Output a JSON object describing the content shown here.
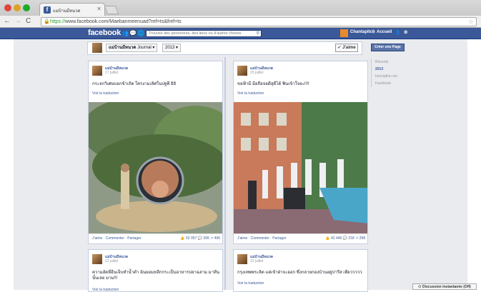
{
  "browser": {
    "tab_title": "แม่บ้านมีหนวด",
    "url_prefix": "https://",
    "url_rest": "www.facebook.com/Maebanmeenuad?ref=ts&fref=ts"
  },
  "facebook_bar": {
    "logo": "facebook",
    "search_placeholder": "Trouvez des personnes, des lieux ou d'autres choses",
    "user_name": "Chantapitch",
    "home_label": "Accueil"
  },
  "page_header": {
    "page_name": "แม่บ้านมีหนวด",
    "section": "Journal",
    "year": "2013",
    "like_button": "✓ J'aime",
    "create_page_button": "Créer une Page"
  },
  "timeline_nav": {
    "items": [
      "Récents",
      "2013",
      "Inscription sur Facebook"
    ]
  },
  "posts": [
    {
      "author": "แม่บ้านมีหนวด",
      "date": "17 juillet",
      "text": "กระจกวิเศษบอกข้าเถิด ใครงามเลิศในปฐพี อิอิ",
      "translate": "Voir la traduction",
      "actions": "J'aime · Commenter · Partager",
      "likes": "52 057",
      "comments": "399",
      "shares": "496"
    },
    {
      "author": "แม่บ้านมีหนวด",
      "date": "15 juillet",
      "text": "ขอฟ้ามี มีอถือจอดีสุดีได้ ฟินเข้าใจอะ!!!!",
      "translate": "Voir la traduction",
      "actions": "J'aime · Commenter · Partager",
      "likes": "42 446",
      "comments": "218",
      "shares": "298"
    },
    {
      "author": "แม่บ้านมีหนวด",
      "date": "13 juillet",
      "text": "ความอัดที่อีนเจ็บทำน้ำตำ ฉันยอมหลีกกระเป็นอาหารปลาฉลาม มาทีนนั้นเลย มาม!!!",
      "translate": "Voir la traduction"
    },
    {
      "author": "แม่บ้านมีหนวด",
      "date": "12 juillet",
      "text": "กรุงเทพพระลิต แต่เข้าฝ่าจะออก ซึ่งกลายกองบ้านอยู่ปารีส เพียววววว",
      "translate": "Voir la traduction"
    }
  ],
  "chat": {
    "label": "Discussion instantanée (Off)"
  }
}
